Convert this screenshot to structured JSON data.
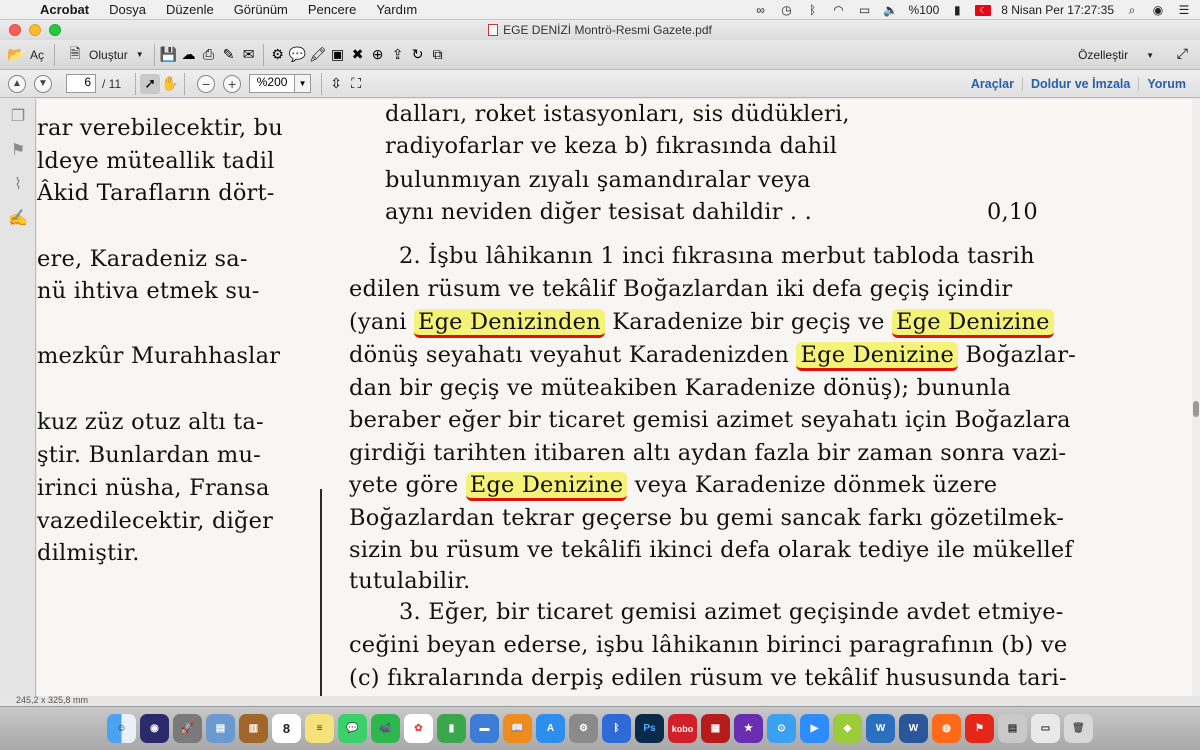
{
  "menubar": {
    "app": "Acrobat",
    "items": [
      "Dosya",
      "Düzenle",
      "Görünüm",
      "Pencere",
      "Yardım"
    ],
    "battery": "%100",
    "datetime": "8 Nisan Per  17:27:35"
  },
  "window": {
    "title": "EGE DENİZİ Montrö-Resmi Gazete.pdf"
  },
  "toolbar": {
    "open_label": "Aç",
    "create_label": "Oluştur",
    "customize_label": "Özelleştir"
  },
  "nav": {
    "page_current": "6",
    "page_total": "/ 11",
    "zoom": "%200",
    "tools_label": "Araçlar",
    "fill_sign_label": "Doldur ve İmzala",
    "comment_label": "Yorum"
  },
  "status": {
    "dimensions": "245,2 x 325,8 mm"
  },
  "document": {
    "left_lines": [
      "rar verebilecektir, bu",
      "ldeye müteallik tadil",
      "Âkid Tarafların dört-",
      "ere,  Karadeniz  sa-",
      "nü ihtiva  etmek su-",
      "mezkûr  Murahhaslar",
      "kuz züz otuz altı ta-",
      "ştir. Bunlardan  mu-",
      "irinci  nüsha, Fransa",
      " vazedilecektir, diğer",
      "dilmiştir."
    ],
    "right_lines": [
      "dalları, roket istasyonları, sis düdükleri,",
      "radiyofarlar  ve  keza b) fıkrasında dahil",
      "bulunmıyan  zıyalı  şamandıralar  veya",
      "aynı neviden diğer  tesisat dahildir .   .",
      "0,10",
      "2. İşbu lâhikanın 1 inci fıkrasına  merbut tabloda  tasrih",
      "edilen  rüsum  ve tekâlif  Boğazlardan  iki defa  geçiş  içindir",
      "(yani ",
      "Ege Deniz",
      "inden",
      "  Karadenize bir  geçiş ve ",
      "Ege  Denizine",
      "dönüş seyahatı veyahut Karadenizden ",
      "Ege Denizine",
      " Boğazlar-",
      "dan  bir  geçiş ve müteakiben  Karadenize  dönüş);  bununla",
      "beraber eğer bir ticaret gemisi azimet seyahatı için Boğazlara",
      "girdiği tarihten itibaren altı aydan fazla bir zaman sonra vazi-",
      "yete  göre ",
      "Ege Denizine",
      "  veya  Karadenize  dönmek  üzere",
      "Boğazlardan  tekrar geçerse bu gemi sancak farkı gözetilmek-",
      "sizin bu rüsum ve tekâlifi ikinci defa olarak tediye ile mükellef",
      "tutulabilir.",
      "3. Eğer, bir ticaret gemisi azimet  geçişinde  avdet etmiye-",
      "ceğini  beyan ederse, işbu lâhikanın birinci paragrafının (b) ve",
      "(c) fıkralarında  derpiş edilen rüsum ve tekâlif hususunda tari-"
    ]
  },
  "dock": {
    "calendar_day": "8",
    "kobo_label": "kobo"
  },
  "colors": {
    "highlight": "#f5f27a",
    "underline": "#e01010",
    "link": "#2a5fa8"
  }
}
